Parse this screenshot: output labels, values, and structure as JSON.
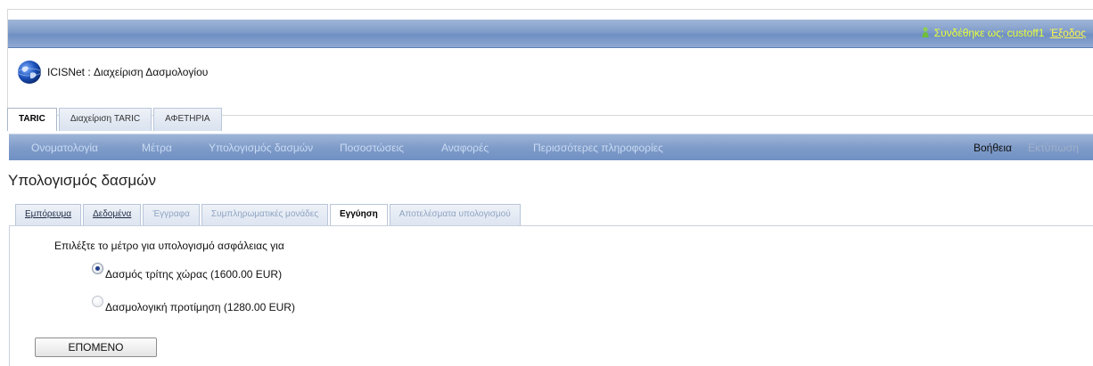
{
  "header": {
    "login_prefix": "Συνδέθηκε ως:",
    "username": "custoff1",
    "logout_label": "Έξοδος",
    "app_title": "ICISNet : Διαχείριση Δασμολογίου"
  },
  "main_tabs": [
    {
      "label": "TARIC",
      "active": true
    },
    {
      "label": "Διαχείριση TARIC",
      "active": false
    },
    {
      "label": "ΑΦΕΤΗΡΙΑ",
      "active": false
    }
  ],
  "menu": {
    "items": [
      "Ονοματολογία",
      "Μέτρα",
      "Υπολογισμός δασμών",
      "Ποσοστώσεις",
      "Αναφορές",
      "Περισσότερες πληροφορίες"
    ],
    "help": "Βοήθεια",
    "print": "Εκτύπωση"
  },
  "page": {
    "title": "Υπολογισμός δασμών"
  },
  "sub_tabs": [
    {
      "label": "Εμπόρευμα",
      "state": "normal"
    },
    {
      "label": "Δεδομένα",
      "state": "normal"
    },
    {
      "label": "Έγγραφα",
      "state": "disabled"
    },
    {
      "label": "Συμπληρωματικές μονάδες",
      "state": "disabled"
    },
    {
      "label": "Εγγύηση",
      "state": "active"
    },
    {
      "label": "Αποτελέσματα υπολογισμού",
      "state": "disabled"
    }
  ],
  "guarantee": {
    "prompt": "Επιλέξτε το μέτρο για υπολογισμό ασφάλειας για",
    "options": [
      {
        "label": "Δασμός τρίτης χώρας (1600.00 EUR)",
        "checked": true
      },
      {
        "label": "Δασμολογική προτίμηση (1280.00 EUR)",
        "checked": false
      }
    ],
    "next_label": "ΕΠΟΜΕΝΟ"
  },
  "colors": {
    "header_bar": "#7f9cc9",
    "login_text": "#e8ff3a",
    "menu_text": "#c9daf2",
    "disabled_tab_text": "#8ea3c1"
  }
}
